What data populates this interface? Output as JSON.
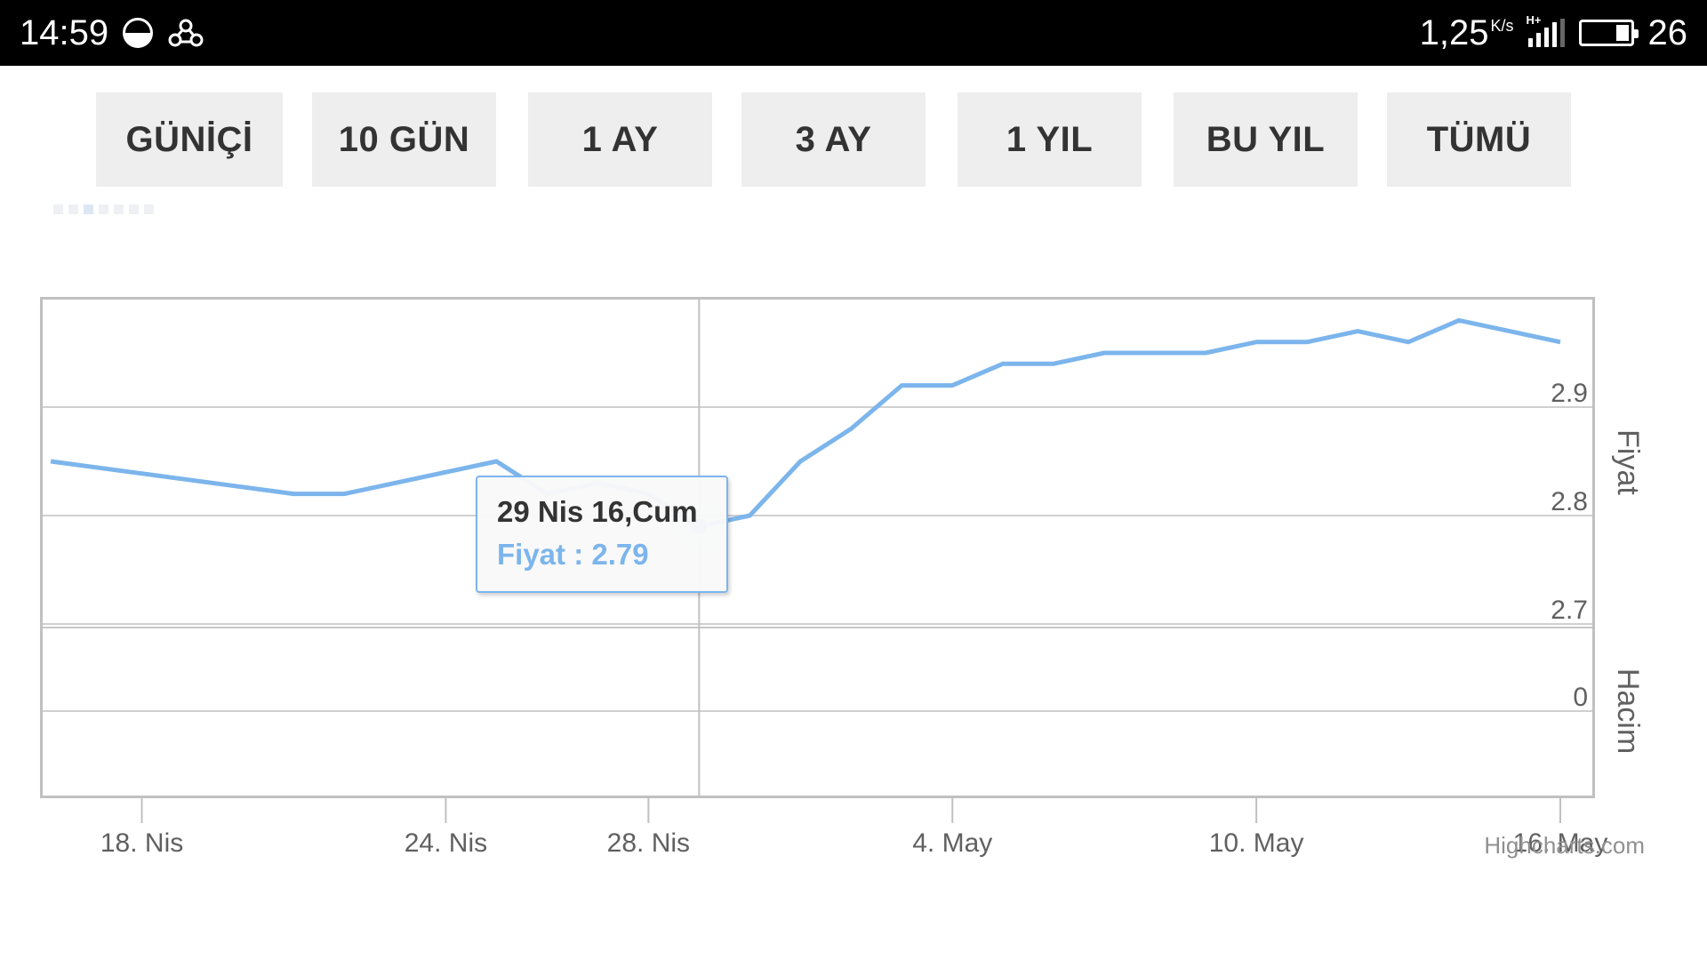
{
  "status_bar": {
    "time": "14:59",
    "network_speed": "1,25",
    "network_unit": "K/s",
    "network_type": "H+",
    "battery_percent": "26",
    "icons": [
      "half-moon-icon",
      "app-notification-icon",
      "signal-icon",
      "battery-icon"
    ]
  },
  "range_buttons": [
    {
      "label": "GÜNİÇİ"
    },
    {
      "label": "10 GÜN"
    },
    {
      "label": "1 AY"
    },
    {
      "label": "3 AY"
    },
    {
      "label": "1 YIL"
    },
    {
      "label": "BU YIL"
    },
    {
      "label": "TÜMÜ"
    }
  ],
  "colors": {
    "series": "#7cb5ec",
    "grid": "#d0d0d0",
    "button_bg": "#eeeeee"
  },
  "tooltip": {
    "title": "29 Nis 16,Cum",
    "series_text": "Fiyat : 2.79"
  },
  "credit": "Highcharts.com",
  "chart_data": {
    "type": "line",
    "title": "",
    "x_tick_labels": [
      "18. Nis",
      "24. Nis",
      "28. Nis",
      "4. May",
      "10. May",
      "16. May"
    ],
    "x_ticks_days": [
      18,
      24,
      28,
      34,
      40,
      46
    ],
    "xlim_days": [
      16.2,
      47.7
    ],
    "series": [
      {
        "name": "Fiyat",
        "x_days": [
          16.2,
          21,
          22,
          25,
          26,
          27,
          28,
          29,
          30,
          31,
          32,
          33,
          34,
          35,
          36,
          37,
          38,
          39,
          40,
          41,
          42,
          43,
          44,
          45,
          46
        ],
        "values": [
          2.85,
          2.82,
          2.82,
          2.85,
          2.82,
          2.83,
          2.82,
          2.79,
          2.8,
          2.85,
          2.88,
          2.92,
          2.92,
          2.94,
          2.94,
          2.95,
          2.95,
          2.95,
          2.96,
          2.96,
          2.97,
          2.96,
          2.98,
          2.97,
          2.96
        ],
        "highlighted_index": 7
      }
    ],
    "x_days_full": [
      16.2,
      17,
      18,
      19,
      20,
      21,
      22,
      23,
      24,
      25,
      26,
      27,
      28,
      29,
      30,
      31,
      32,
      33,
      34,
      35,
      36,
      37,
      38,
      39,
      40
    ],
    "price_axis": {
      "title": "Fiyat",
      "tick_labels": [
        "2.7",
        "2.8",
        "2.9"
      ],
      "ticks": [
        2.7,
        2.8,
        2.9
      ],
      "ylim": [
        2.7,
        3.0
      ]
    },
    "volume_axis": {
      "title": "Hacim",
      "tick_labels": [
        "0"
      ],
      "ticks": [
        0
      ]
    },
    "grid": true,
    "legend": "none"
  }
}
